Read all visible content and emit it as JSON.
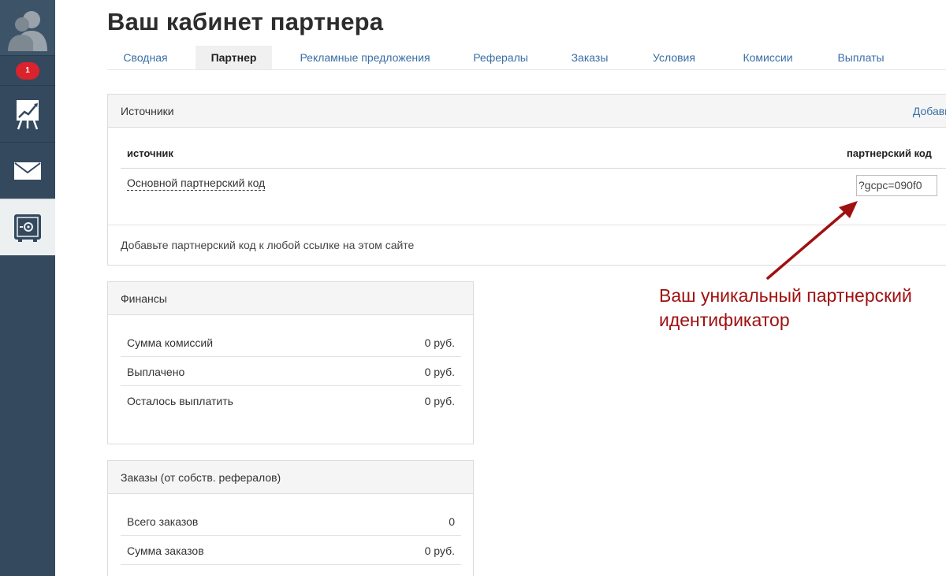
{
  "sidebar": {
    "avatar_icon": "user-silhouette-icon",
    "notification_count": "1",
    "items": [
      {
        "icon": "chart-easel-icon"
      },
      {
        "icon": "envelope-icon"
      },
      {
        "icon": "safe-icon"
      }
    ]
  },
  "header": {
    "title": "Ваш кабинет партнера"
  },
  "tabs": [
    {
      "label": "Сводная"
    },
    {
      "label": "Партнер"
    },
    {
      "label": "Рекламные предложения"
    },
    {
      "label": "Рефералы"
    },
    {
      "label": "Заказы"
    },
    {
      "label": "Условия"
    },
    {
      "label": "Комиссии"
    },
    {
      "label": "Выплаты"
    }
  ],
  "sources": {
    "title": "Источники",
    "add_label": "Добави",
    "col_source": "источник",
    "col_code": "партнерский код",
    "row_name": "Основной партнерский код",
    "code_value": "?gcpc=090f0",
    "hint": "Добавьте партнерский код к любой ссылке на этом сайте"
  },
  "finances": {
    "title": "Финансы",
    "rows": [
      {
        "label": "Сумма комиссий",
        "value": "0 руб."
      },
      {
        "label": "Выплачено",
        "value": "0 руб."
      },
      {
        "label": "Осталось выплатить",
        "value": "0 руб."
      }
    ]
  },
  "orders": {
    "title": "Заказы (от собств. рефералов)",
    "rows": [
      {
        "label": "Всего заказов",
        "value": "0"
      },
      {
        "label": "Сумма заказов",
        "value": "0 руб."
      }
    ]
  },
  "annotation": {
    "text": "Ваш уникальный партнерский идентификатор",
    "color": "#a01010"
  },
  "colors": {
    "sidebar": "#34495e",
    "link": "#3a6ea5",
    "badge": "#d9232d"
  }
}
